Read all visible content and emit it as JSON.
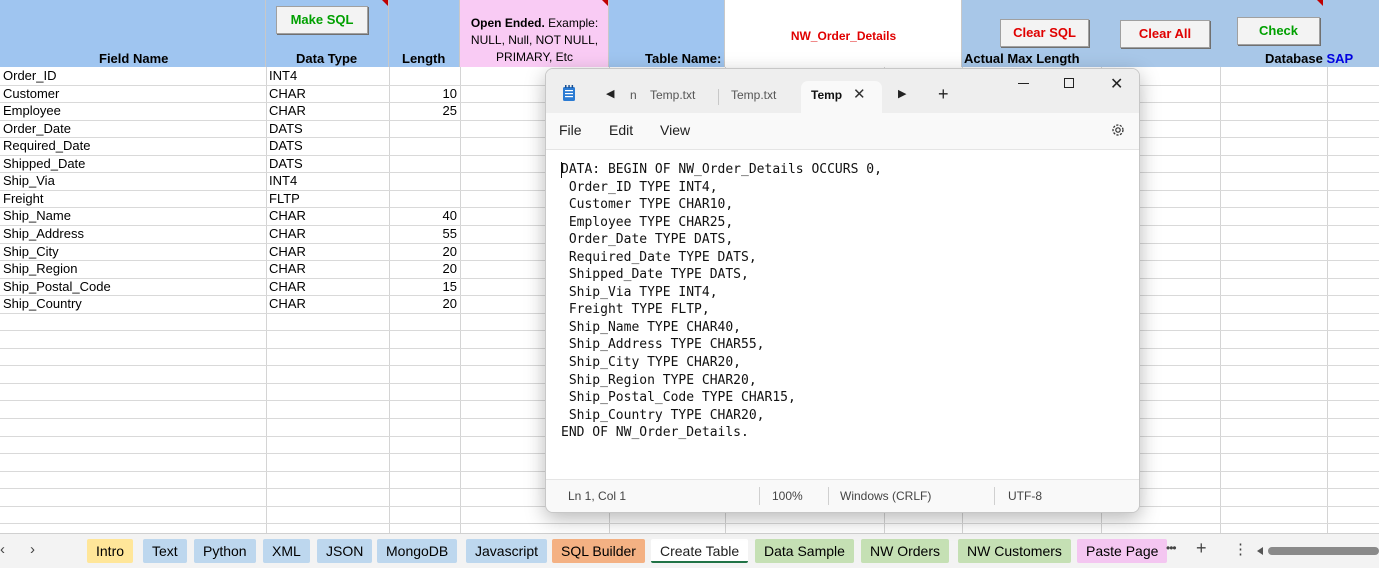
{
  "sheet": {
    "headers": {
      "field_name": "Field Name",
      "data_type": "Data Type",
      "length": "Length",
      "open_ended_bold": "Open Ended.",
      "open_ended_rest": " Example: NULL, Null, NOT NULL, PRIMARY, Etc",
      "table_name_label": "Table Name:",
      "table_name_value": "NW_Order_Details",
      "actual_max_length": "Actual Max Length",
      "database_label": "Database",
      "database_value": "SAP"
    },
    "buttons": {
      "make_sql": "Make SQL",
      "clear_sql": "Clear SQL",
      "clear_all": "Clear All",
      "check": "Check"
    },
    "rows": [
      {
        "field": "Order_ID",
        "type": "INT4",
        "length": ""
      },
      {
        "field": "Customer",
        "type": "CHAR",
        "length": "10"
      },
      {
        "field": "Employee",
        "type": "CHAR",
        "length": "25"
      },
      {
        "field": "Order_Date",
        "type": "DATS",
        "length": ""
      },
      {
        "field": "Required_Date",
        "type": "DATS",
        "length": ""
      },
      {
        "field": "Shipped_Date",
        "type": "DATS",
        "length": ""
      },
      {
        "field": "Ship_Via",
        "type": "INT4",
        "length": ""
      },
      {
        "field": "Freight",
        "type": "FLTP",
        "length": ""
      },
      {
        "field": "Ship_Name",
        "type": "CHAR",
        "length": "40"
      },
      {
        "field": "Ship_Address",
        "type": "CHAR",
        "length": "55"
      },
      {
        "field": "Ship_City",
        "type": "CHAR",
        "length": "20"
      },
      {
        "field": "Ship_Region",
        "type": "CHAR",
        "length": "20"
      },
      {
        "field": "Ship_Postal_Code",
        "type": "CHAR",
        "length": "15"
      },
      {
        "field": "Ship_Country",
        "type": "CHAR",
        "length": "20"
      }
    ]
  },
  "tabs": [
    {
      "label": "Intro",
      "color": "yellow"
    },
    {
      "label": "Text",
      "color": "lblue"
    },
    {
      "label": "Python",
      "color": "lblue"
    },
    {
      "label": "XML",
      "color": "lblue"
    },
    {
      "label": "JSON",
      "color": "lblue"
    },
    {
      "label": "MongoDB",
      "color": "lblue"
    },
    {
      "label": "Javascript",
      "color": "lblue"
    },
    {
      "label": "SQL Builder",
      "color": "orange"
    },
    {
      "label": "Create Table",
      "color": "active"
    },
    {
      "label": "Data Sample",
      "color": "lgreen"
    },
    {
      "label": "NW Orders",
      "color": "lgreen"
    },
    {
      "label": "NW Customers",
      "color": "lgreen"
    },
    {
      "label": "Paste Page",
      "color": "lpink"
    }
  ],
  "tabbar_icons": {
    "prev": "‹",
    "next": "›",
    "more": "•••",
    "add": "+",
    "options": "⋮"
  },
  "notepad": {
    "tabs": [
      {
        "label": "Temp.txt",
        "prefix": "n"
      },
      {
        "label": "Temp.txt"
      },
      {
        "label": "Temp",
        "active": true
      }
    ],
    "menu": [
      "File",
      "Edit",
      "View"
    ],
    "content": "DATA: BEGIN OF NW_Order_Details OCCURS 0,\n Order_ID TYPE INT4,\n Customer TYPE CHAR10,\n Employee TYPE CHAR25,\n Order_Date TYPE DATS,\n Required_Date TYPE DATS,\n Shipped_Date TYPE DATS,\n Ship_Via TYPE INT4,\n Freight TYPE FLTP,\n Ship_Name TYPE CHAR40,\n Ship_Address TYPE CHAR55,\n Ship_City TYPE CHAR20,\n Ship_Region TYPE CHAR20,\n Ship_Postal_Code TYPE CHAR15,\n Ship_Country TYPE CHAR20,\nEND OF NW_Order_Details.",
    "status": {
      "position": "Ln 1, Col 1",
      "zoom": "100%",
      "line_endings": "Windows (CRLF)",
      "encoding": "UTF-8"
    }
  },
  "colors": {
    "header_blue": "#9fc5f0",
    "header_pink": "#f9cbf4",
    "button_green": "#00a000",
    "button_red": "#e00000",
    "database_blue": "#0000e0"
  }
}
